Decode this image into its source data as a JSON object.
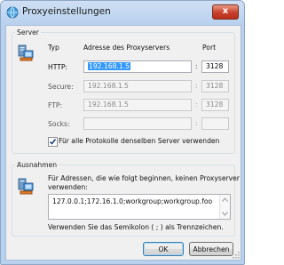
{
  "window": {
    "title": "Proxyeinstellungen",
    "close_glyph": "x"
  },
  "server": {
    "legend": "Server",
    "col_type": "Typ",
    "col_address": "Adresse des Proxyservers",
    "col_port": "Port",
    "rows": [
      {
        "label": "HTTP:",
        "address": "192.168.1.5",
        "port": "3128",
        "enabled": true
      },
      {
        "label": "Secure:",
        "address": "192.168.1.5",
        "port": "3128",
        "enabled": false
      },
      {
        "label": "FTP:",
        "address": "192.168.1.5",
        "port": "3128",
        "enabled": false
      },
      {
        "label": "Socks:",
        "address": "",
        "port": "",
        "enabled": false
      }
    ],
    "colon": ":",
    "same_server_label": "Für alle Protokolle denselben Server verwenden",
    "same_server_checked": true
  },
  "exceptions": {
    "legend": "Ausnahmen",
    "description_line1": "Für Adressen, die wie folgt beginnen, keinen Proxyserver",
    "description_line2": "verwenden:",
    "value": "127.0.0.1;172.16.1.0;workgroup;workgroup.foo",
    "hint": "Verwenden Sie das Semikolon ( ; ) als Trennzeichen."
  },
  "buttons": {
    "ok": "OK",
    "cancel": "Abbrechen"
  },
  "colors": {
    "title_bar": "#b9d1ee",
    "close_button": "#c8402a",
    "selection": "#3399ff"
  },
  "icons": [
    "network-globe-icon",
    "server-computer-icon",
    "computer-shield-icon"
  ]
}
